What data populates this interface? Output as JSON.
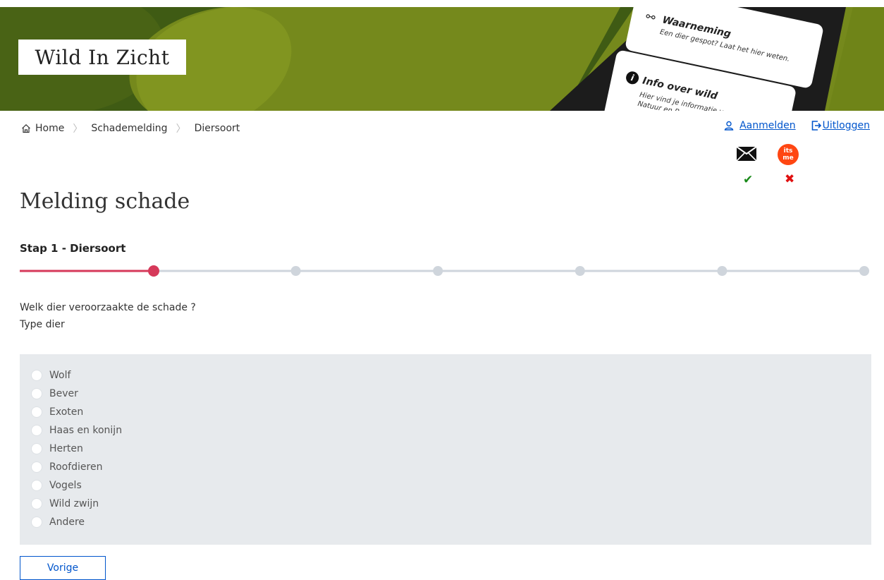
{
  "banner": {
    "logo": "Wild In Zicht",
    "card1": {
      "title": "Waarneming",
      "subtitle": "Een dier gespot? Laat het hier weten."
    },
    "card2": {
      "title": "Info over wild",
      "subtitle_line1": "Hier vind je informatie v...",
      "subtitle_line2": "Natuur en Bos..."
    }
  },
  "breadcrumb": {
    "home": "Home",
    "items": [
      "Schademelding",
      "Diersoort"
    ]
  },
  "toplinks": {
    "login": "Aanmelden",
    "logout": "Uitloggen"
  },
  "auth_status": {
    "itsme_label_top": "its",
    "itsme_label_bottom": "me",
    "mail_ok": "✔",
    "itsme_ok": "✖"
  },
  "page": {
    "title": "Melding schade",
    "step_label": "Stap 1 - Diersoort",
    "question": "Welk dier veroorzaakte de schade ?",
    "subquestion": "Type dier"
  },
  "stepper": {
    "total_steps": 6,
    "current_step": 1
  },
  "options": [
    "Wolf",
    "Bever",
    "Exoten",
    "Haas en konijn",
    "Herten",
    "Roofdieren",
    "Vogels",
    "Wild zwijn",
    "Andere"
  ],
  "buttons": {
    "previous": "Vorige"
  },
  "colors": {
    "accent": "#d6395a",
    "link": "#0055cc",
    "banner_dark": "#3f5b14",
    "banner_light": "#7a8a1e",
    "panel": "#e7eaed",
    "step_inactive": "#cfd5dc"
  }
}
